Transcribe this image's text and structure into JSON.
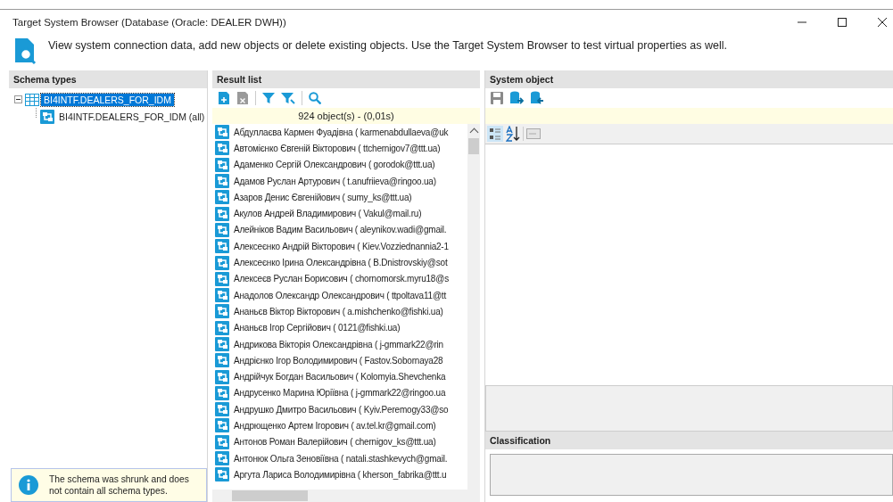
{
  "window": {
    "title": "Target System Browser (Database (Oracle: DEALER DWH))"
  },
  "description": "View system connection data, add new objects or delete existing objects. Use the Target System Browser to test virtual properties as well.",
  "schema_types": {
    "header": "Schema types",
    "tree": [
      {
        "label": "BI4INTF.DEALERS_FOR_IDM",
        "selected": true,
        "expanded": true,
        "children": [
          {
            "label": "BI4INTF.DEALERS_FOR_IDM (all)",
            "selected": false
          }
        ]
      }
    ],
    "info": "The schema was shrunk and does not contain all schema types."
  },
  "result_list": {
    "header": "Result list",
    "count": "924 object(s) - (0,01s)",
    "rows": [
      "Абдуллаєва Кармен Фуадівна ( karmenabdullaeva@uk",
      "Автомієнко Євгеній Вікторович ( ttchernigov7@ttt.ua)",
      "Адаменко Сергій Олександрович ( gorodok@ttt.ua)",
      "Адамов Руслан Артурович ( t.anufriieva@ringoo.ua)",
      "Азаров Денис Євгенійович ( sumy_ks@ttt.ua)",
      "Акулов Андрей Владимирович ( Vakul@mail.ru)",
      "Алейніков Вадим Васильович ( aleynikov.wadi@gmail.",
      "Алексеєнко Андрій Вікторович ( Kiev.Vozziednannia2-1",
      "Алексеєнко Ірина Олександрівна ( B.Dnistrovskiy@sot",
      "Алексеєв Руслан Борисович ( chornomorsk.myru18@s",
      "Анадолов Олександр Олександрович ( ttpoltava11@tt",
      "Ананьєв Віктор Вікторович ( a.mishchenko@fishki.ua)",
      "Ананьєв Ігор Сергійович ( 0121@fishki.ua)",
      "Андрикова Вікторія Олександрівна ( j-gmmark22@rin",
      "Андрієнко Ігор Володимирович ( Fastov.Sobornaya28",
      "Андрійчук Богдан Васильович ( Kolomyia.Shevchenka",
      "Андрусенко Марина Юріївна ( j-gmmark22@ringoo.ua",
      "Андрушко Дмитро Васильович ( Kyiv.Peremogy33@so",
      "Андрющенко Артем Ігорович ( av.tel.kr@gmail.com)",
      "Антонов Роман Валерійович ( chernigov_ks@ttt.ua)",
      "Антонюк Ольга Зеновіївна ( natali.stashkevych@gmail.",
      "Аргута Лариса Володимирівна ( kherson_fabrika@ttt.u"
    ]
  },
  "system_object": {
    "header": "System object",
    "classification": "Classification"
  }
}
